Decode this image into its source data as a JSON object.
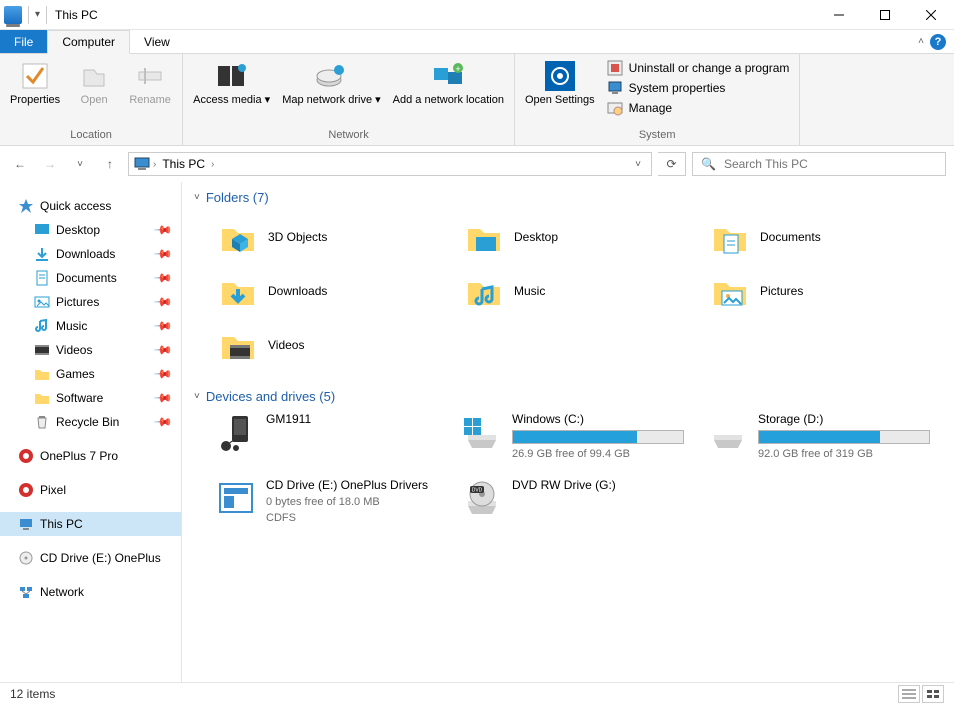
{
  "title": "This PC",
  "tabs": {
    "file": "File",
    "computer": "Computer",
    "view": "View"
  },
  "ribbon": {
    "location": {
      "label": "Location",
      "properties": "Properties",
      "open": "Open",
      "rename": "Rename"
    },
    "network": {
      "label": "Network",
      "access_media": "Access media ▾",
      "map_drive": "Map network drive ▾",
      "add_location": "Add a network location"
    },
    "system": {
      "label": "System",
      "open_settings": "Open Settings",
      "uninstall": "Uninstall or change a program",
      "sysprops": "System properties",
      "manage": "Manage"
    }
  },
  "breadcrumb": {
    "root": "This PC"
  },
  "search": {
    "placeholder": "Search This PC"
  },
  "sidebar": {
    "quick_access": "Quick access",
    "pinned": [
      {
        "label": "Desktop"
      },
      {
        "label": "Downloads"
      },
      {
        "label": "Documents"
      },
      {
        "label": "Pictures"
      },
      {
        "label": "Music"
      },
      {
        "label": "Videos"
      },
      {
        "label": "Games"
      },
      {
        "label": "Software"
      },
      {
        "label": "Recycle Bin"
      }
    ],
    "devices": [
      {
        "label": "OnePlus 7 Pro"
      },
      {
        "label": "Pixel"
      }
    ],
    "this_pc": "This PC",
    "cd_drive": "CD Drive (E:) OnePlus",
    "network": "Network"
  },
  "sections": {
    "folders_header": "Folders (7)",
    "drives_header": "Devices and drives (5)"
  },
  "folders": [
    {
      "label": "3D Objects"
    },
    {
      "label": "Desktop"
    },
    {
      "label": "Documents"
    },
    {
      "label": "Downloads"
    },
    {
      "label": "Music"
    },
    {
      "label": "Pictures"
    },
    {
      "label": "Videos"
    }
  ],
  "drives": {
    "gm": {
      "label": "GM1911"
    },
    "c": {
      "label": "Windows (C:)",
      "free": "26.9 GB free of 99.4 GB",
      "pct": 73
    },
    "d": {
      "label": "Storage (D:)",
      "free": "92.0 GB free of 319 GB",
      "pct": 71
    },
    "e": {
      "label": "CD Drive (E:) OnePlus Drivers",
      "free": "0 bytes free of 18.0 MB",
      "fs": "CDFS"
    },
    "g": {
      "label": "DVD RW Drive (G:)"
    }
  },
  "status": {
    "count": "12 items"
  }
}
